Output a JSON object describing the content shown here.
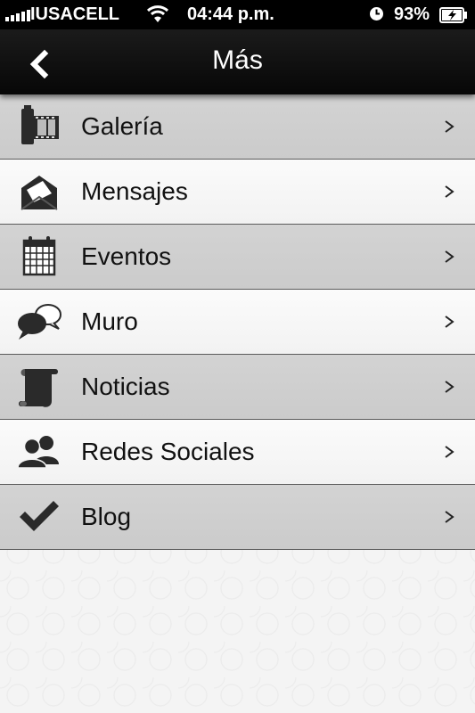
{
  "status_bar": {
    "carrier": "IUSACELL",
    "time": "04:44 p.m.",
    "battery_percent": "93%",
    "signal_bars": 5,
    "icons": [
      "signal-icon",
      "wifi-icon",
      "clock-icon",
      "battery-charging-icon"
    ]
  },
  "nav": {
    "title": "Más",
    "back_icon": "back-arrow-icon"
  },
  "menu": {
    "items": [
      {
        "label": "Galería",
        "icon": "film-camera-icon"
      },
      {
        "label": "Mensajes",
        "icon": "envelope-icon"
      },
      {
        "label": "Eventos",
        "icon": "calendar-icon"
      },
      {
        "label": "Muro",
        "icon": "speech-bubbles-icon"
      },
      {
        "label": "Noticias",
        "icon": "scroll-icon"
      },
      {
        "label": "Redes Sociales",
        "icon": "people-icon"
      },
      {
        "label": "Blog",
        "icon": "checkmark-icon"
      }
    ],
    "row_shading": [
      "dark",
      "light",
      "dark",
      "light",
      "dark",
      "light",
      "dark"
    ],
    "chevron_icon": "chevron-right-icon"
  },
  "colors": {
    "status_bar_bg": "#000000",
    "nav_bg": "#111111",
    "row_dark": "#cfcfcf",
    "row_light": "#f7f7f7",
    "text": "#111111"
  }
}
